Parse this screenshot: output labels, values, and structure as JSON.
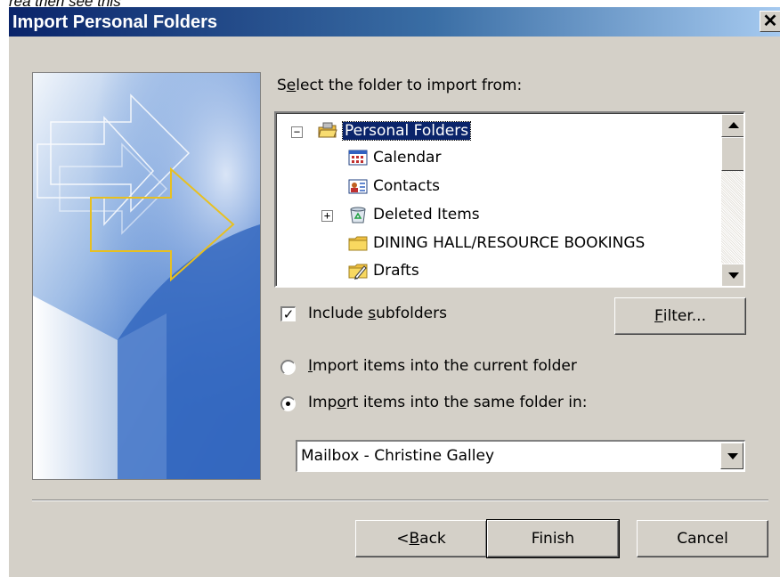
{
  "caption": "rea then see this",
  "dialog": {
    "title": "Import Personal Folders",
    "close_glyph": "✕"
  },
  "folder_section": {
    "label_pre": "S",
    "label_u": "e",
    "label_post": "lect the folder to import from:"
  },
  "tree": {
    "items": [
      {
        "label": "Personal Folders",
        "icon": "personal-folders-icon",
        "expander": "−",
        "selected": true
      },
      {
        "label": "Calendar",
        "icon": "calendar-icon"
      },
      {
        "label": "Contacts",
        "icon": "contacts-icon"
      },
      {
        "label": "Deleted Items",
        "icon": "deleted-items-icon",
        "expander": "+"
      },
      {
        "label": "DINING HALL/RESOURCE BOOKINGS",
        "icon": "folder-icon"
      },
      {
        "label": "Drafts",
        "icon": "drafts-icon"
      }
    ]
  },
  "options": {
    "include_subfolders": {
      "pre": "Include ",
      "u": "s",
      "post": "ubfolders",
      "checked": true
    },
    "filter_button": {
      "pre": "",
      "u": "F",
      "post": "ilter..."
    },
    "radio_current": {
      "pre": "",
      "u": "I",
      "post": "mport items into the current folder",
      "selected": false
    },
    "radio_same": {
      "pre": "Imp",
      "u": "o",
      "post": "rt items into the same folder in:",
      "selected": true
    }
  },
  "mailbox_dropdown": {
    "value": "Mailbox - Christine Galley"
  },
  "buttons": {
    "back": {
      "pre": "< ",
      "u": "B",
      "post": "ack"
    },
    "finish": "Finish",
    "cancel": "Cancel"
  },
  "colors": {
    "titlebar_start": "#0a246a",
    "titlebar_end": "#a6caf0",
    "dialog_bg": "#d4d0c8",
    "selection": "#0a246a",
    "wizard_arrow": "#e8c020"
  }
}
